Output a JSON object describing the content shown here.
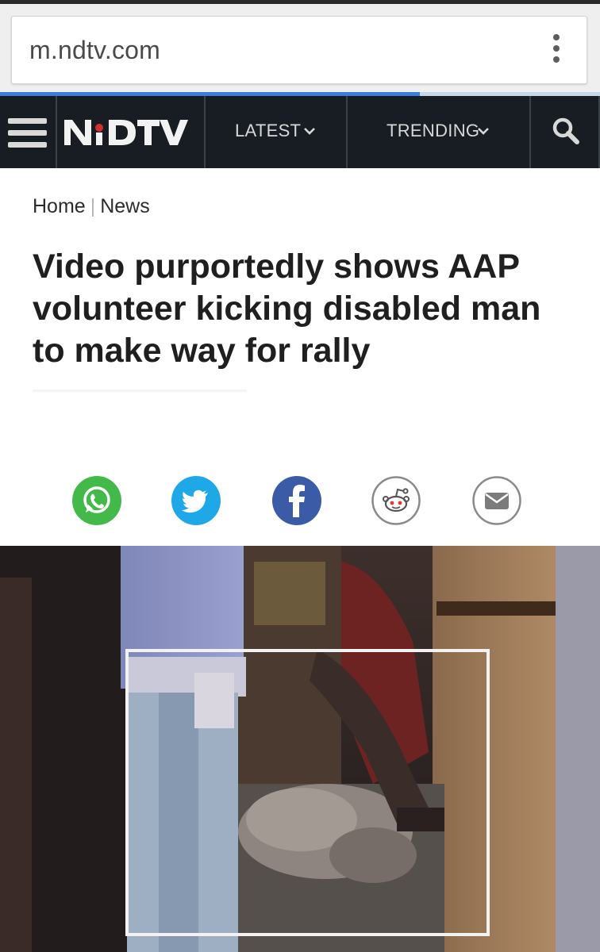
{
  "browser": {
    "url": "m.ndtv.com",
    "menu_icon": "overflow-menu-icon",
    "load_progress": 0.7
  },
  "nav": {
    "brand": "NDTV",
    "latest_label": "LATEST",
    "trending_label": "TRENDING",
    "brand_color": "#d32f2f",
    "background": "#171d22"
  },
  "breadcrumb": {
    "home": "Home",
    "separator": "|",
    "section": "News"
  },
  "article": {
    "headline": "Video purportedly shows AAP volunteer kicking disabled man to make way for rally"
  },
  "share": {
    "icons": [
      "whatsapp-icon",
      "twitter-icon",
      "facebook-icon",
      "reddit-icon",
      "email-icon"
    ],
    "colors": {
      "whatsapp": "#43b94a",
      "twitter": "#1ea8e8",
      "facebook": "#3b5ba7",
      "outline": "#8a8a8a"
    }
  }
}
